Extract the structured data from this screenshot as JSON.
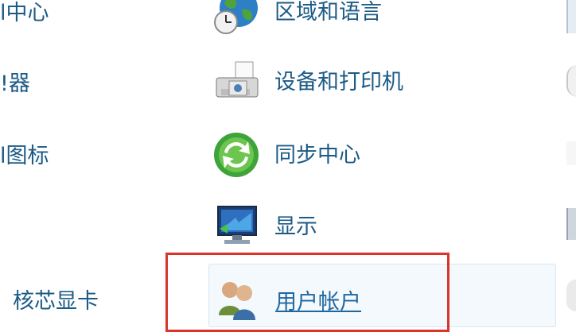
{
  "left_column": [
    {
      "label": "l中心"
    },
    {
      "label": "!器"
    },
    {
      "label": "l图标"
    },
    {
      "label": "核芯显卡"
    }
  ],
  "items": [
    {
      "label": "区域和语言",
      "icon": "region-language-icon"
    },
    {
      "label": "设备和打印机",
      "icon": "devices-printers-icon"
    },
    {
      "label": "同步中心",
      "icon": "sync-center-icon"
    },
    {
      "label": "显示",
      "icon": "display-icon"
    },
    {
      "label": "用户帐户",
      "icon": "user-accounts-icon"
    }
  ],
  "colors": {
    "link": "#1c5b86",
    "highlight_box": "#d9352b"
  }
}
